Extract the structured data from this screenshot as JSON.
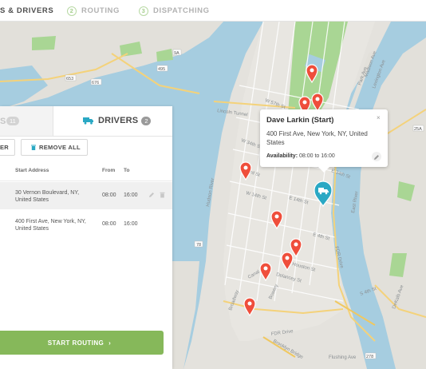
{
  "steps": [
    {
      "num": "",
      "label": "S & DRIVERS"
    },
    {
      "num": "2",
      "label": "ROUTING"
    },
    {
      "num": "3",
      "label": "DISPATCHING"
    }
  ],
  "tabs": {
    "orders_label": "S",
    "orders_count": "11",
    "drivers_label": "DRIVERS",
    "drivers_count": "2"
  },
  "buttons": {
    "add_label": "ER",
    "remove_all_label": "REMOVE ALL",
    "start_routing_label": "START ROUTING"
  },
  "table": {
    "headers": {
      "address": "Start Address",
      "from": "From",
      "to": "To"
    },
    "rows": [
      {
        "address": "30 Vernon Boulevard, NY, United States",
        "from": "08:00",
        "to": "16:00"
      },
      {
        "address": "400 First Ave, New York, NY, United States",
        "from": "08:00",
        "to": "16:00"
      }
    ]
  },
  "popup": {
    "title": "Dave Larkin (Start)",
    "address": "400 First Ave, New York, NY, United States",
    "availability_label": "Availability:",
    "availability_value": "08:00 to 16:00"
  },
  "map": {
    "labels": {
      "lincoln_tunnel": "Lincoln Tunnel",
      "hudson_river": "Hudson River",
      "east_river": "East River",
      "fdr_drive": "FDR Drive",
      "brooklyn_bridge": "Brooklyn Bridge",
      "w14": "W 14th St",
      "e14": "E 14th St",
      "houston": "Houston St",
      "delancey": "Delancey St",
      "canal": "Canal St",
      "broadway": "Broadway",
      "flushing": "Flushing Ave",
      "dekalb": "DeKalb Ave",
      "park_ave": "Park Ave",
      "madison": "Madison Ave",
      "lexington": "Lexington Ave",
      "w57": "W 57th St",
      "w34": "W 34th St",
      "e34": "E 34th St",
      "w23": "W 23rd St",
      "bowery": "Bowery",
      "e4": "E 4th St",
      "s4": "S 4th St",
      "route_9a": "9A",
      "route_78": "78",
      "route_495": "495",
      "route_676": "676",
      "route_653": "653",
      "route_278": "278",
      "route_25a": "25A"
    }
  },
  "colors": {
    "accent_green": "#86b85a",
    "pin_red": "#ef4e3b",
    "driver_teal": "#2aa8c4",
    "water": "#a6cde0",
    "park": "#a9d694"
  }
}
